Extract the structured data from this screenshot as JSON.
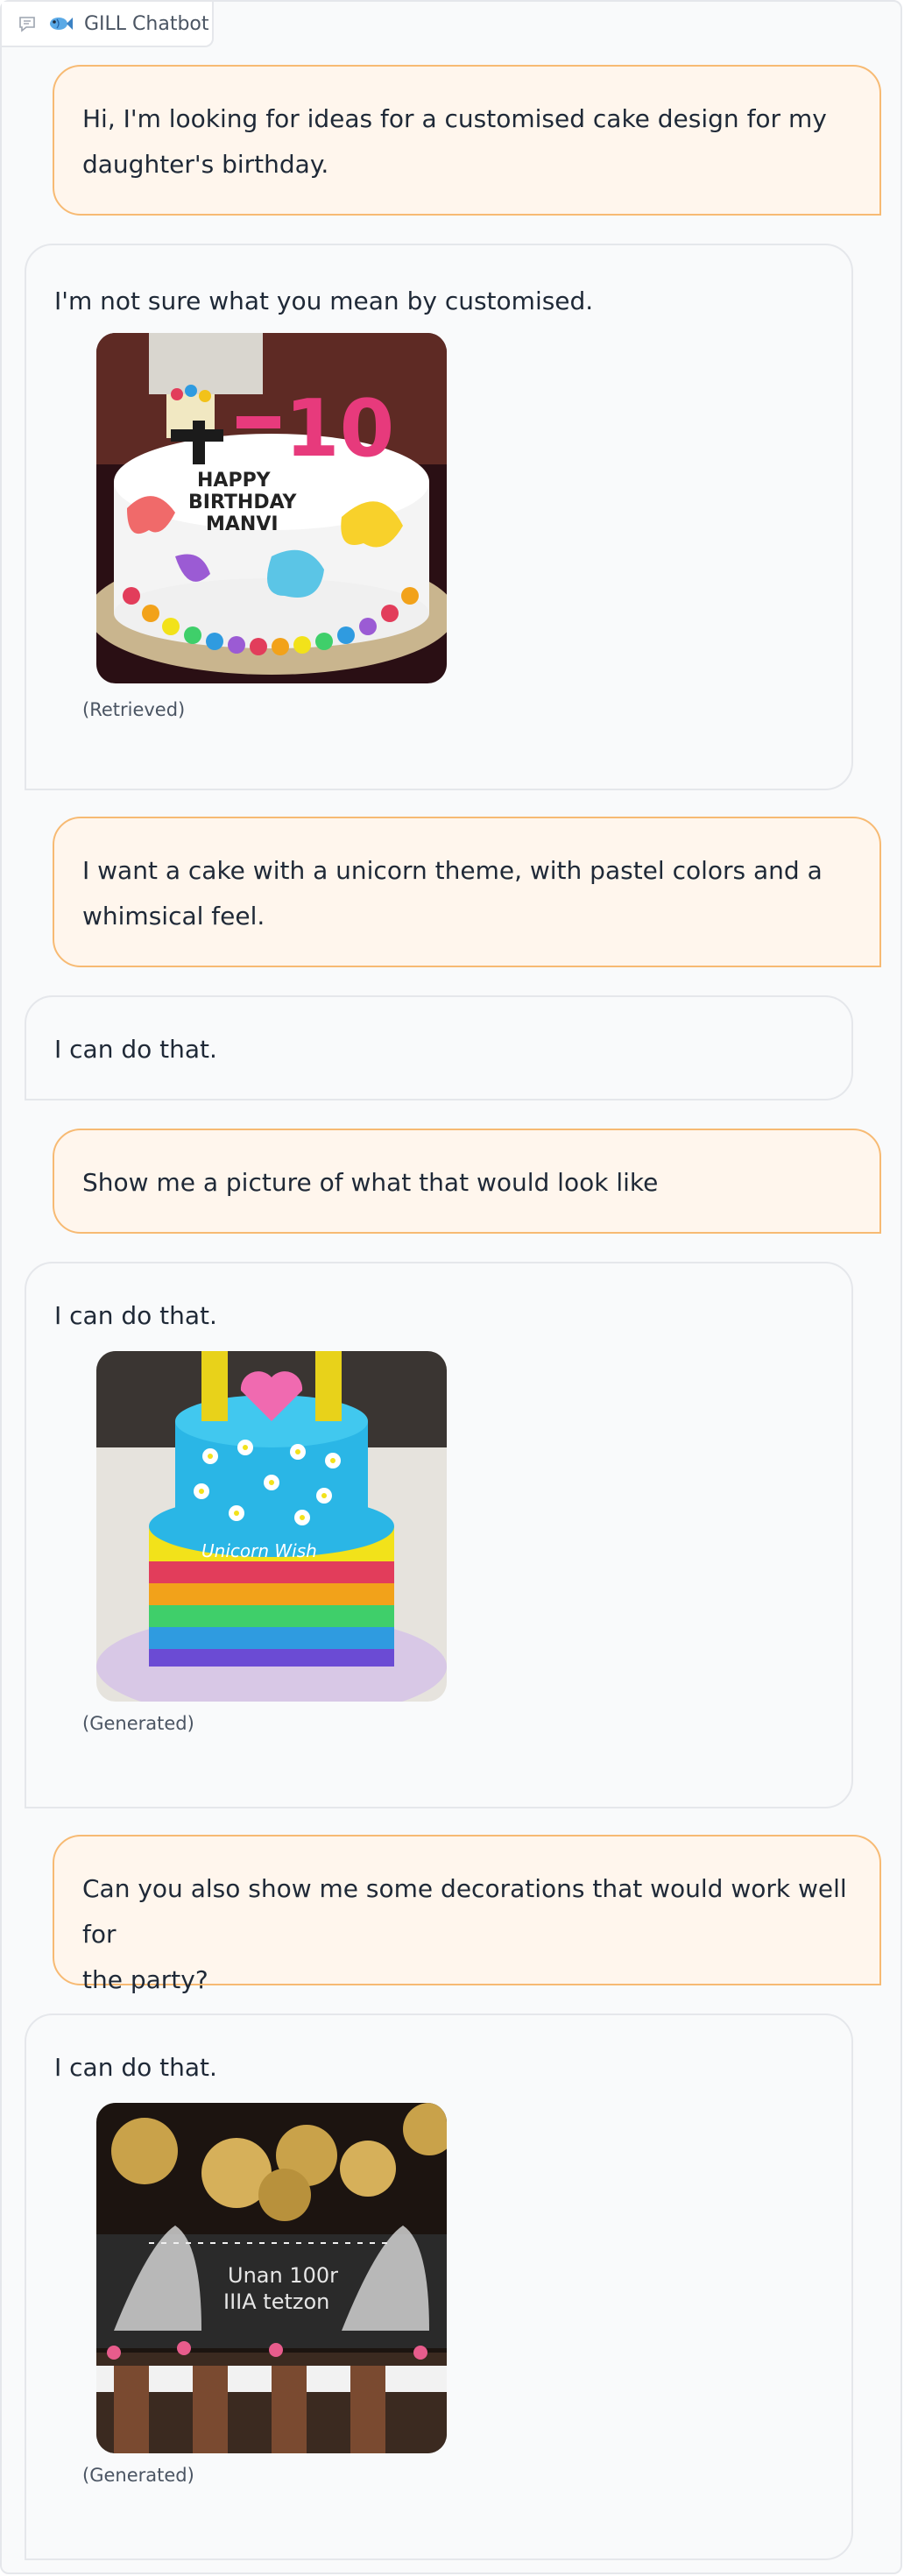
{
  "app": {
    "title": "GILL Chatbot"
  },
  "icons": {
    "chat_label": "chat-bubble-icon",
    "bot_logo": "fish-icon"
  },
  "colors": {
    "user_bubble_bg": "#fff6ed",
    "user_bubble_border": "#f7ba73",
    "bot_bubble_bg": "#f9fafb",
    "bot_bubble_border": "#e5e7eb"
  },
  "messages": [
    {
      "role": "user",
      "text_lines": [
        "Hi, I'm looking for ideas for a customised cake design for my",
        "daughter's birthday."
      ]
    },
    {
      "role": "bot",
      "text": "I'm not sure what you mean by customised.",
      "image": "cake-with-happy-birthday-image",
      "caption": "(Retrieved)"
    },
    {
      "role": "user",
      "text_lines": [
        "I want a cake with a unicorn theme, with pastel colors and a",
        "whimsical feel."
      ]
    },
    {
      "role": "bot",
      "text": "I can do that."
    },
    {
      "role": "user",
      "text_lines": [
        "Show me a picture of what that would look like"
      ]
    },
    {
      "role": "bot",
      "text": "I can do that.",
      "image": "rainbow-layer-cake-image",
      "caption": "(Generated)"
    },
    {
      "role": "user",
      "text_lines": [
        "Can you also show me some decorations that would work well for",
        "the party?"
      ]
    },
    {
      "role": "bot",
      "text": "I can do that.",
      "image": "party-decorations-image",
      "caption": "(Generated)"
    }
  ]
}
